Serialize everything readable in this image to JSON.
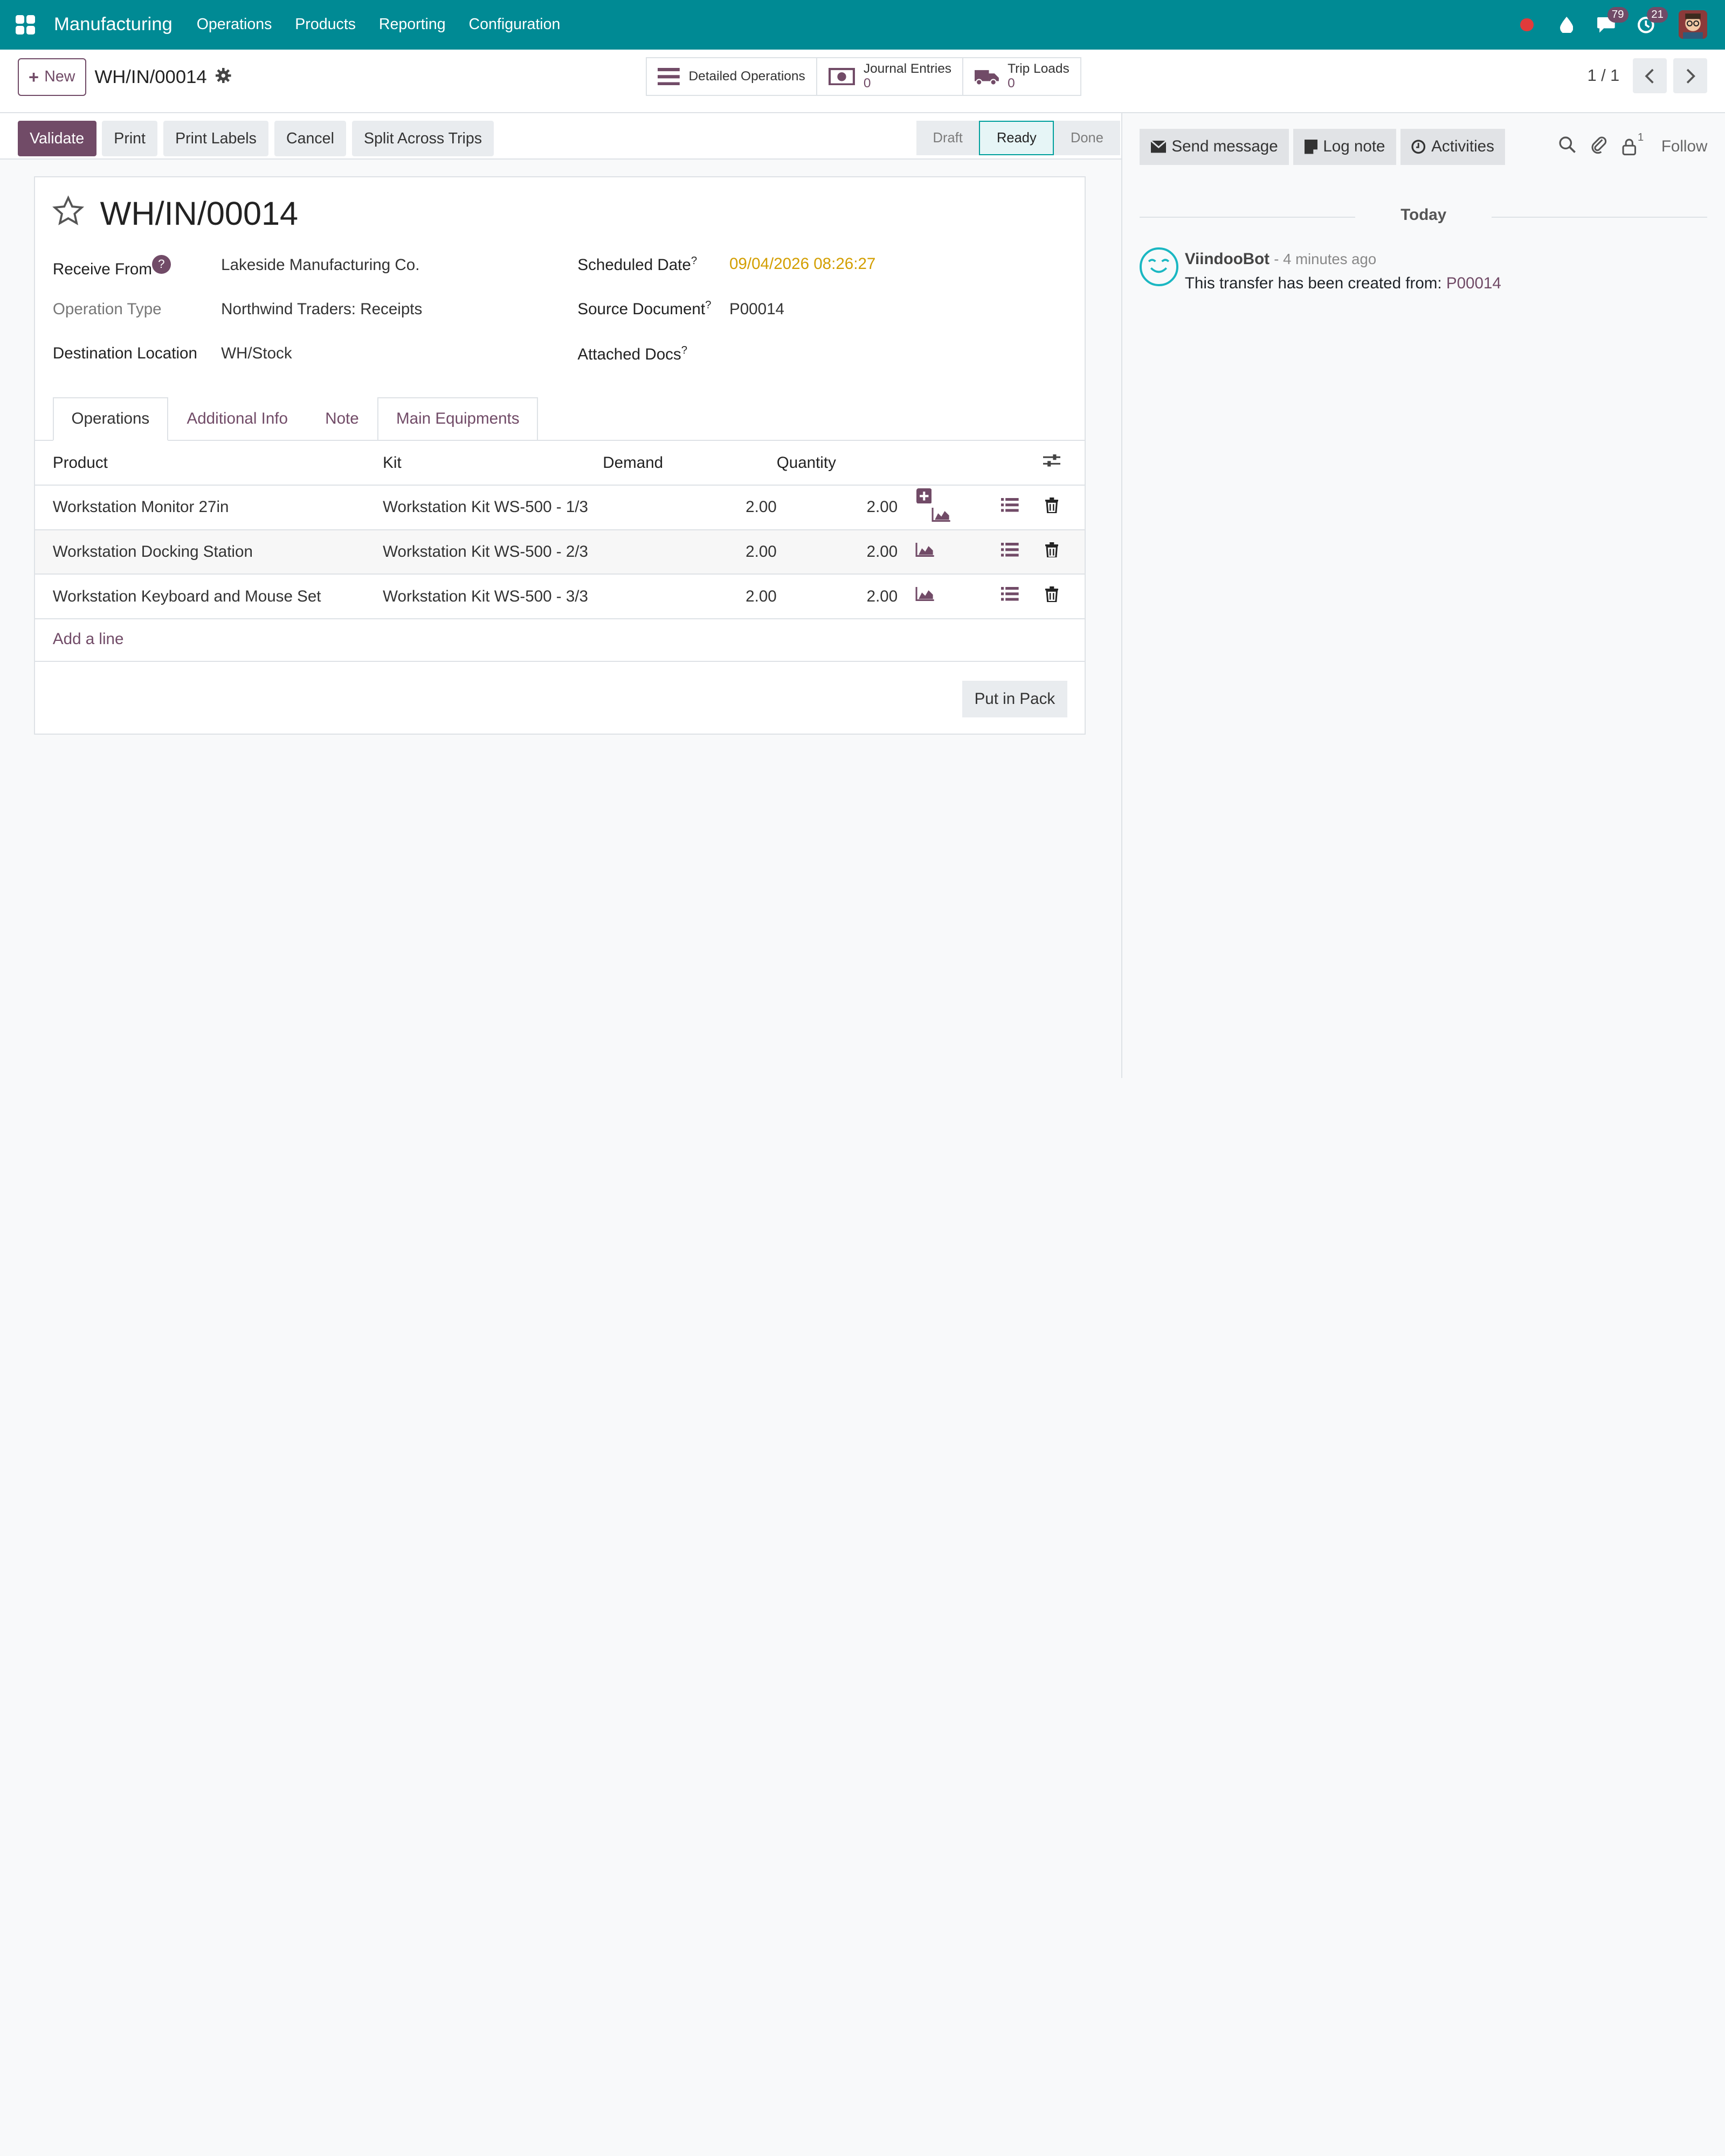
{
  "navbar": {
    "app_name": "Manufacturing",
    "menu": [
      "Operations",
      "Products",
      "Reporting",
      "Configuration"
    ],
    "messages_count": "79",
    "activities_count": "21"
  },
  "control": {
    "new_label": "New",
    "breadcrumb": "WH/IN/00014",
    "smart_buttons": [
      {
        "label": "Detailed Operations",
        "count": ""
      },
      {
        "label": "Journal Entries",
        "count": "0"
      },
      {
        "label": "Trip Loads",
        "count": "0"
      }
    ],
    "pager": "1 / 1"
  },
  "statusbar": {
    "buttons": [
      "Validate",
      "Print",
      "Print Labels",
      "Cancel",
      "Split Across Trips"
    ],
    "stages": [
      "Draft",
      "Ready",
      "Done"
    ],
    "active_stage": "Ready"
  },
  "form": {
    "title": "WH/IN/00014",
    "receive_from_label": "Receive From",
    "receive_from": "Lakeside Manufacturing Co.",
    "operation_type_label": "Operation Type",
    "operation_type": "Northwind Traders: Receipts",
    "destination_label": "Destination Location",
    "destination": "WH/Stock",
    "scheduled_date_label": "Scheduled Date",
    "scheduled_date": "09/04/2026 08:26:27",
    "source_doc_label": "Source Document",
    "source_doc": "P00014",
    "attached_docs_label": "Attached Docs",
    "tabs": [
      "Operations",
      "Additional Info",
      "Note",
      "Main Equipments"
    ],
    "columns": [
      "Product",
      "Kit",
      "Demand",
      "Quantity"
    ],
    "rows": [
      {
        "product": "Workstation Monitor 27in",
        "kit": "Workstation Kit WS-500 - 1/3",
        "demand": "2.00",
        "quantity": "2.00"
      },
      {
        "product": "Workstation Docking Station",
        "kit": "Workstation Kit WS-500 - 2/3",
        "demand": "2.00",
        "quantity": "2.00"
      },
      {
        "product": "Workstation Keyboard and Mouse Set",
        "kit": "Workstation Kit WS-500 - 3/3",
        "demand": "2.00",
        "quantity": "2.00"
      }
    ],
    "add_line": "Add a line",
    "put_in_pack": "Put in Pack"
  },
  "chatter": {
    "send_message": "Send message",
    "log_note": "Log note",
    "activities": "Activities",
    "followers_count": "1",
    "follow": "Follow",
    "today": "Today",
    "message": {
      "author": "ViindooBot",
      "when": "- 4 minutes ago",
      "text": "This transfer has been created from: ",
      "link": "P00014"
    }
  },
  "colors": {
    "navbar": "#008a94",
    "brand": "#714b67",
    "date": "#d39e00",
    "bot": "#1ab7c2"
  }
}
